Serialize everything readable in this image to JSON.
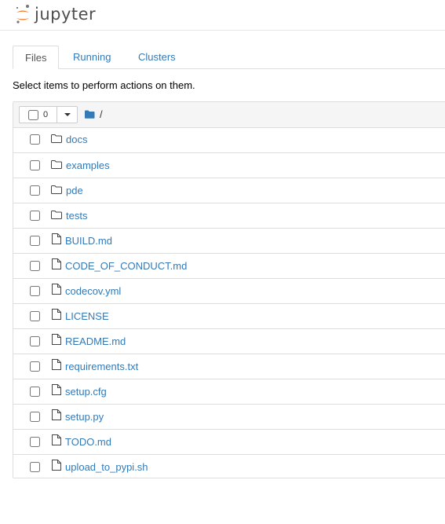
{
  "app": {
    "logo_text": "jupyter"
  },
  "tabs": [
    {
      "label": "Files",
      "active": true
    },
    {
      "label": "Running",
      "active": false
    },
    {
      "label": "Clusters",
      "active": false
    }
  ],
  "toolbar": {
    "hint": "Select items to perform actions on them."
  },
  "list": {
    "selected_count": "0",
    "breadcrumb_root": "/",
    "items": [
      {
        "name": "docs",
        "type": "folder"
      },
      {
        "name": "examples",
        "type": "folder"
      },
      {
        "name": "pde",
        "type": "folder"
      },
      {
        "name": "tests",
        "type": "folder"
      },
      {
        "name": "BUILD.md",
        "type": "file"
      },
      {
        "name": "CODE_OF_CONDUCT.md",
        "type": "file"
      },
      {
        "name": "codecov.yml",
        "type": "file"
      },
      {
        "name": "LICENSE",
        "type": "file"
      },
      {
        "name": "README.md",
        "type": "file"
      },
      {
        "name": "requirements.txt",
        "type": "file"
      },
      {
        "name": "setup.cfg",
        "type": "file"
      },
      {
        "name": "setup.py",
        "type": "file"
      },
      {
        "name": "TODO.md",
        "type": "file"
      },
      {
        "name": "upload_to_pypi.sh",
        "type": "file"
      }
    ]
  },
  "colors": {
    "link": "#337ab7",
    "accent": "#f37726",
    "border": "#dddddd"
  },
  "icons": {
    "folder": "folder-icon",
    "file": "file-icon",
    "root": "folder-open-icon"
  }
}
